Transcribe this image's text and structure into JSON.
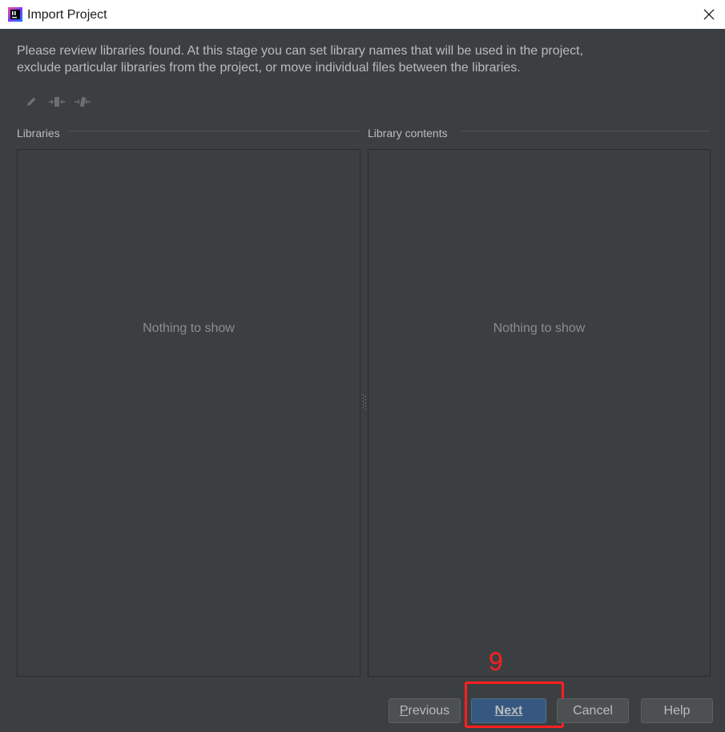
{
  "window": {
    "title": "Import Project",
    "app_icon": "intellij-idea-icon",
    "close_icon": "close-icon"
  },
  "description": {
    "line1": "Please review libraries found. At this stage you can set library names that will be used in the project,",
    "line2": "exclude particular libraries from the project, or move individual files between the libraries."
  },
  "toolbar": {
    "buttons": [
      {
        "icon": "edit-pencil-icon"
      },
      {
        "icon": "exclude-library-icon"
      },
      {
        "icon": "move-files-icon"
      }
    ]
  },
  "libraries": {
    "label": "Libraries",
    "empty_text": "Nothing to show"
  },
  "library_contents": {
    "label": "Library contents",
    "empty_text": "Nothing to show"
  },
  "annotation": {
    "step_number": "9",
    "color": "#ff1f1f"
  },
  "buttons": {
    "previous": {
      "mnemonic": "P",
      "rest": "revious"
    },
    "next": {
      "mnemonic": "N",
      "rest": "ext"
    },
    "cancel": "Cancel",
    "help": "Help"
  },
  "colors": {
    "background": "#3c3f41",
    "titlebar": "#ffffff",
    "primary_button": "#365880",
    "text": "#bbbbbb"
  }
}
